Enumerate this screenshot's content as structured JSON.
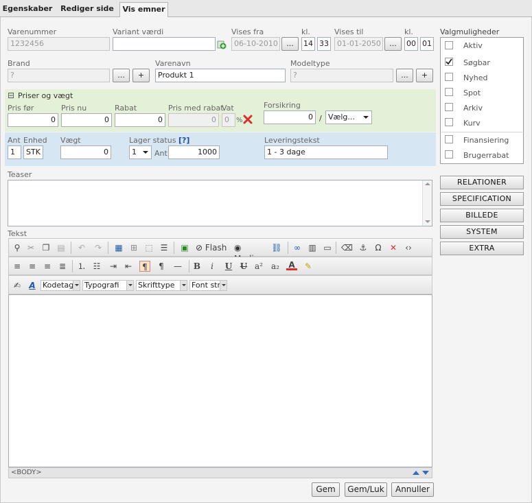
{
  "tabs": [
    {
      "label": "Egenskaber"
    },
    {
      "label": "Rediger side"
    },
    {
      "label": "Vis emner"
    }
  ],
  "fields": {
    "varenummer": {
      "label": "Varenummer",
      "value": "1232456"
    },
    "variant": {
      "label": "Variant værdi",
      "value": ""
    },
    "vises_fra": {
      "label": "Vises fra",
      "value": "06-10-2010",
      "kl_label": "kl.",
      "hour": "14",
      "minute": "33"
    },
    "vises_til": {
      "label": "Vises til",
      "value": "01-01-2050",
      "kl_label": "kl.",
      "hour": "00",
      "minute": "01"
    },
    "brand": {
      "label": "Brand",
      "value": "?"
    },
    "varenavn": {
      "label": "Varenavn",
      "value": "Produkt 1"
    },
    "modeltype": {
      "label": "Modeltype",
      "value": "?"
    }
  },
  "buttons": {
    "ellipsis": "...",
    "plus": "+"
  },
  "prices": {
    "section_label": "Priser og vægt",
    "collapse_icon": "⊟",
    "pris_for": {
      "label": "Pris før",
      "value": "0"
    },
    "pris_nu": {
      "label": "Pris nu",
      "value": "0"
    },
    "rabat": {
      "label": "Rabat",
      "value": "0"
    },
    "pris_med_rabat": {
      "label": "Pris med rabat",
      "value": "0"
    },
    "vat": {
      "label": "Vat",
      "value": "0",
      "unit": "%"
    },
    "forsikring": {
      "label": "Forsikring",
      "value": "0",
      "sep": "/",
      "select": "Vælg..."
    }
  },
  "stock": {
    "ant_label": "Ant",
    "ant_value": "1",
    "enhed_label": "Enhed",
    "enhed_value": "STK",
    "vaegt_label": "Vægt",
    "vaegt_value": "0",
    "lager_label": "Lager status",
    "lager_help": "[?]",
    "lager_select": "1",
    "lager_ant_label": "Ant",
    "lager_ant_value": "1000",
    "levering_label": "Leveringstekst",
    "levering_value": "1 - 3 dage"
  },
  "teaser_label": "Teaser",
  "tekst_label": "Tekst",
  "editor": {
    "toolbar3": {
      "kodetag": "Kodetag",
      "typografi": "Typografi",
      "skrifttype": "Skrifttype",
      "fontstr": "Font str."
    },
    "flash": "Flash",
    "media": "Media",
    "status": "<BODY>"
  },
  "valg": {
    "title": "Valgmuligheder",
    "items": [
      {
        "label": "Aktiv",
        "checked": false
      },
      {
        "label": "Søgbar",
        "checked": true
      },
      {
        "label": "Nyhed",
        "checked": false
      },
      {
        "label": "Spot",
        "checked": false
      },
      {
        "label": "Arkiv",
        "checked": false
      },
      {
        "label": "Kurv",
        "checked": false
      },
      {
        "label": "Finansiering",
        "checked": false
      },
      {
        "label": "Brugerrabat",
        "checked": false
      }
    ]
  },
  "side_buttons": [
    "RELATIONER",
    "SPECIFICATION",
    "BILLEDE",
    "SYSTEM",
    "EXTRA"
  ],
  "footer": {
    "gem": "Gem",
    "gem_luk": "Gem/Luk",
    "annuller": "Annuller"
  },
  "colors": {
    "green_section": "#e5f0d8",
    "blue_section": "#d6e6f2",
    "check_mark": "#222",
    "red_x": "#d9302b"
  }
}
